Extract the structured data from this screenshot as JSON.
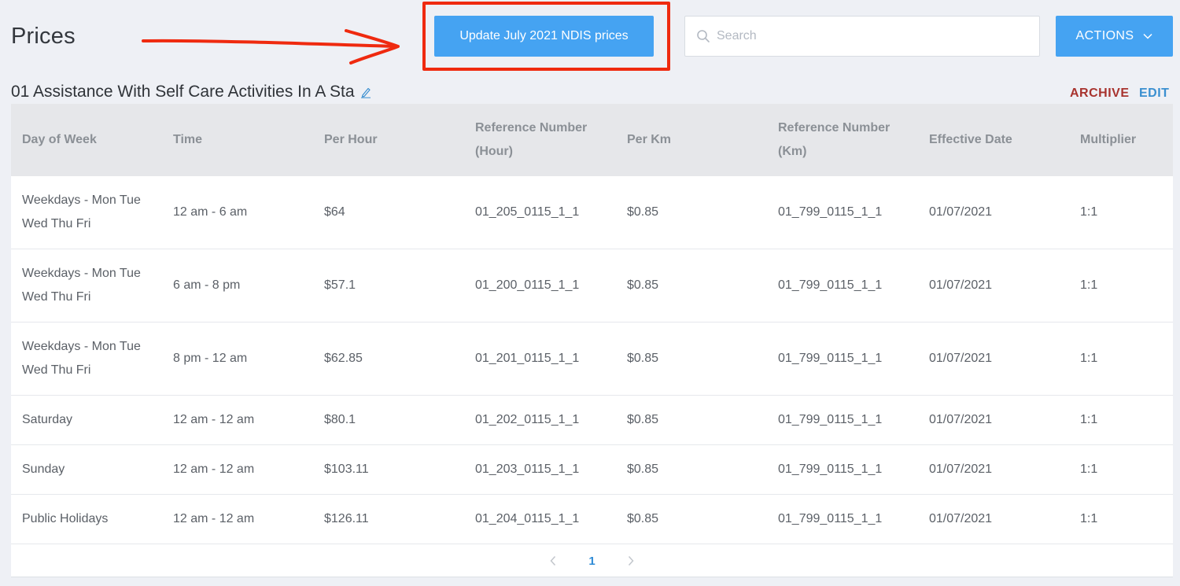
{
  "header": {
    "title": "Prices",
    "update_button_label": "Update July 2021 NDIS prices",
    "search_placeholder": "Search",
    "actions_label": "ACTIONS"
  },
  "section": {
    "title": "01 Assistance With Self Care Activities In A Sta",
    "archive_label": "ARCHIVE",
    "edit_label": "EDIT"
  },
  "table": {
    "headers": {
      "day_of_week": "Day of Week",
      "time": "Time",
      "per_hour": "Per Hour",
      "ref_hour_1": "Reference Number",
      "ref_hour_2": "(Hour)",
      "per_km": "Per Km",
      "ref_km_1": "Reference Number",
      "ref_km_2": "(Km)",
      "effective_date": "Effective Date",
      "multiplier": "Multiplier"
    },
    "rows": [
      {
        "day_1": "Weekdays - Mon Tue",
        "day_2": "Wed Thu Fri",
        "time": "12 am - 6 am",
        "per_hour": "$64",
        "ref_hour": "01_205_0115_1_1",
        "per_km": "$0.85",
        "ref_km": "01_799_0115_1_1",
        "effective_date": "01/07/2021",
        "multiplier": "1:1"
      },
      {
        "day_1": "Weekdays - Mon Tue",
        "day_2": "Wed Thu Fri",
        "time": "6 am - 8 pm",
        "per_hour": "$57.1",
        "ref_hour": "01_200_0115_1_1",
        "per_km": "$0.85",
        "ref_km": "01_799_0115_1_1",
        "effective_date": "01/07/2021",
        "multiplier": "1:1"
      },
      {
        "day_1": "Weekdays - Mon Tue",
        "day_2": "Wed Thu Fri",
        "time": "8 pm - 12 am",
        "per_hour": "$62.85",
        "ref_hour": "01_201_0115_1_1",
        "per_km": "$0.85",
        "ref_km": "01_799_0115_1_1",
        "effective_date": "01/07/2021",
        "multiplier": "1:1"
      },
      {
        "day_1": "Saturday",
        "day_2": "",
        "time": "12 am - 12 am",
        "per_hour": "$80.1",
        "ref_hour": "01_202_0115_1_1",
        "per_km": "$0.85",
        "ref_km": "01_799_0115_1_1",
        "effective_date": "01/07/2021",
        "multiplier": "1:1"
      },
      {
        "day_1": "Sunday",
        "day_2": "",
        "time": "12 am - 12 am",
        "per_hour": "$103.11",
        "ref_hour": "01_203_0115_1_1",
        "per_km": "$0.85",
        "ref_km": "01_799_0115_1_1",
        "effective_date": "01/07/2021",
        "multiplier": "1:1"
      },
      {
        "day_1": "Public Holidays",
        "day_2": "",
        "time": "12 am - 12 am",
        "per_hour": "$126.11",
        "ref_hour": "01_204_0115_1_1",
        "per_km": "$0.85",
        "ref_km": "01_799_0115_1_1",
        "effective_date": "01/07/2021",
        "multiplier": "1:1"
      }
    ]
  },
  "pagination": {
    "current_page": "1",
    "prev_icon": "chevron-left-icon",
    "next_icon": "chevron-right-icon"
  },
  "icons": {
    "search": "search-icon",
    "actions_dropdown": "chevron-down-icon",
    "title_edit": "pencil-icon"
  },
  "colors": {
    "primary_button": "#45a3f2",
    "annotation_red": "#ef2a0f",
    "archive": "#a8332e",
    "edit": "#3a8fd0",
    "page_background": "#eef0f5",
    "table_header_background": "#e6e7ea"
  }
}
